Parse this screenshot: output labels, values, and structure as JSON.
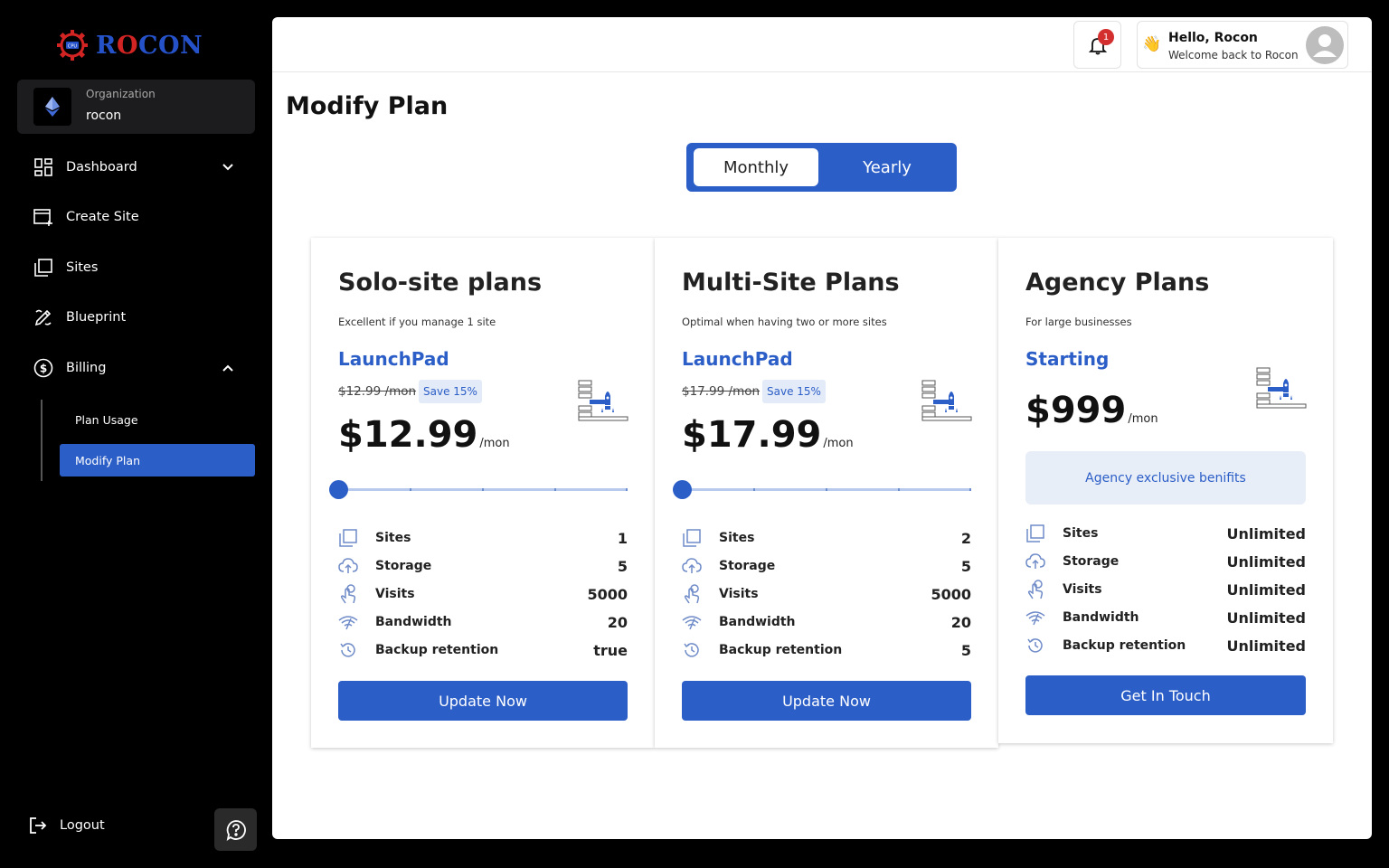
{
  "brand": {
    "name_part1": "R",
    "name_part2": "O",
    "name_part3": "CON",
    "chip_text": "CPU"
  },
  "organization": {
    "label": "Organization",
    "name": "rocon"
  },
  "sidebar": {
    "items": [
      {
        "label": "Dashboard",
        "icon": "dashboard-icon"
      },
      {
        "label": "Create Site",
        "icon": "create-site-icon"
      },
      {
        "label": "Sites",
        "icon": "sites-icon"
      },
      {
        "label": "Blueprint",
        "icon": "blueprint-icon"
      },
      {
        "label": "Billing",
        "icon": "dollar-icon"
      }
    ],
    "billing_sub": [
      {
        "label": "Plan Usage"
      },
      {
        "label": "Modify Plan",
        "active": true
      }
    ],
    "logout_label": "Logout"
  },
  "header": {
    "notification_count": "1",
    "greeting": "Hello, Rocon",
    "welcome": "Welcome back to Rocon",
    "wave_emoji": "👋"
  },
  "page": {
    "title": "Modify Plan"
  },
  "billing_toggle": {
    "monthly": "Monthly",
    "yearly": "Yearly",
    "selected": "Monthly"
  },
  "colors": {
    "accent": "#2c5ec7",
    "accent_light": "#e3ebf8",
    "badge": "#d32f2f"
  },
  "plans": [
    {
      "title": "Solo-site plans",
      "description": "Excellent if you manage 1 site",
      "tier": "LaunchPad",
      "old_price": "$12.99 /mon",
      "save": "Save 15%",
      "price": "$12.99",
      "per": "/mon",
      "slider_level": 0,
      "features": [
        {
          "label": "Sites",
          "value": "1"
        },
        {
          "label": "Storage",
          "value": "5"
        },
        {
          "label": "Visits",
          "value": "5000"
        },
        {
          "label": "Bandwidth",
          "value": "20"
        },
        {
          "label": "Backup retention",
          "value": "true"
        }
      ],
      "cta": "Update Now"
    },
    {
      "title": "Multi-Site Plans",
      "description": "Optimal when having two or more sites",
      "tier": "LaunchPad",
      "old_price": "$17.99 /mon",
      "save": "Save 15%",
      "price": "$17.99",
      "per": "/mon",
      "slider_level": 0,
      "features": [
        {
          "label": "Sites",
          "value": "2"
        },
        {
          "label": "Storage",
          "value": "5"
        },
        {
          "label": "Visits",
          "value": "5000"
        },
        {
          "label": "Bandwidth",
          "value": "20"
        },
        {
          "label": "Backup retention",
          "value": "5"
        }
      ],
      "cta": "Update Now"
    },
    {
      "title": "Agency Plans",
      "description": "For large businesses",
      "tier": "Starting",
      "price": "$999",
      "per": "/mon",
      "benefits": "Agency exclusive benifits",
      "features": [
        {
          "label": "Sites",
          "value": "Unlimited"
        },
        {
          "label": "Storage",
          "value": "Unlimited"
        },
        {
          "label": "Visits",
          "value": "Unlimited"
        },
        {
          "label": "Bandwidth",
          "value": "Unlimited"
        },
        {
          "label": "Backup retention",
          "value": "Unlimited"
        }
      ],
      "cta": "Get In Touch"
    }
  ]
}
